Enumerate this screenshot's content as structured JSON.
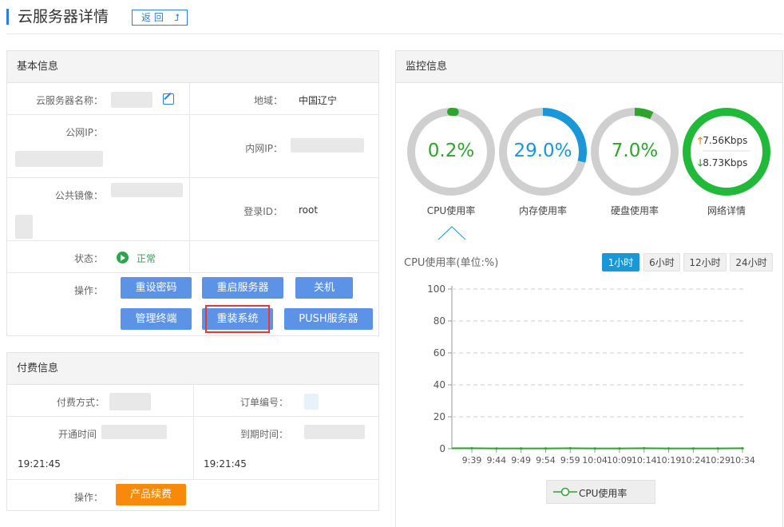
{
  "header": {
    "title": "云服务器详情",
    "back_label": "返 回"
  },
  "basic": {
    "title": "基本信息",
    "server_name_label": "云服务器名称：",
    "region_label": "地域：",
    "region_value": "中国辽宁",
    "public_ip_label": "公网IP：",
    "private_ip_label": "内网IP：",
    "image_label": "公共镜像：",
    "login_label": "登录ID：",
    "login_value": "root",
    "status_label": "状态：",
    "status_value": "正常",
    "ops_label": "操作：",
    "buttons": [
      "重设密码",
      "重启服务器",
      "关机",
      "管理终端",
      "重装系统",
      "PUSH服务器"
    ]
  },
  "billing": {
    "title": "付费信息",
    "pay_method_label": "付费方式：",
    "order_label": "订单编号：",
    "open_time_label": "开通时间",
    "open_time_value": "19:21:45",
    "expire_label": "到期时间：",
    "expire_value": "19:21:45",
    "ops_label": "操作：",
    "renew_button": "产品续费"
  },
  "monitor": {
    "title": "监控信息",
    "gauges": [
      {
        "label": "CPU使用率",
        "value": "0.2%",
        "percent": 0.2,
        "color": "#2ea42e"
      },
      {
        "label": "内存使用率",
        "value": "29.0%",
        "percent": 29.0,
        "color": "#1a97d6"
      },
      {
        "label": "硬盘使用率",
        "value": "7.0%",
        "percent": 7.0,
        "color": "#2ea42e"
      },
      {
        "label": "网络详情",
        "up": "7.56Kbps",
        "down": "8.73Kbps",
        "color": "#22b93a"
      }
    ],
    "chart_title": "CPU使用率(单位:%)",
    "time_tabs": [
      "1小时",
      "6小时",
      "12小时",
      "24小时"
    ],
    "active_tab": "1小时"
  },
  "colors": {
    "accent": "#2e7de1",
    "button": "#5c93e6",
    "orange": "#f88a0b",
    "green": "#2ea42e"
  },
  "chart_data": {
    "type": "line",
    "x": [
      "9:39",
      "9:44",
      "9:49",
      "9:54",
      "9:59",
      "10:04",
      "10:09",
      "10:14",
      "10:19",
      "10:24",
      "10:29",
      "10:34"
    ],
    "series": [
      {
        "name": "CPU使用率",
        "values": [
          0.3,
          0.2,
          0.2,
          0.2,
          0.3,
          0.2,
          0.2,
          0.3,
          0.2,
          0.2,
          0.2,
          0.3
        ]
      }
    ],
    "ylim": [
      0,
      100
    ],
    "yticks": [
      0,
      20,
      40,
      60,
      80,
      100
    ],
    "title": "CPU使用率(单位:%)",
    "xlabel": "",
    "ylabel": "",
    "grid": true,
    "legend": "bottom"
  }
}
